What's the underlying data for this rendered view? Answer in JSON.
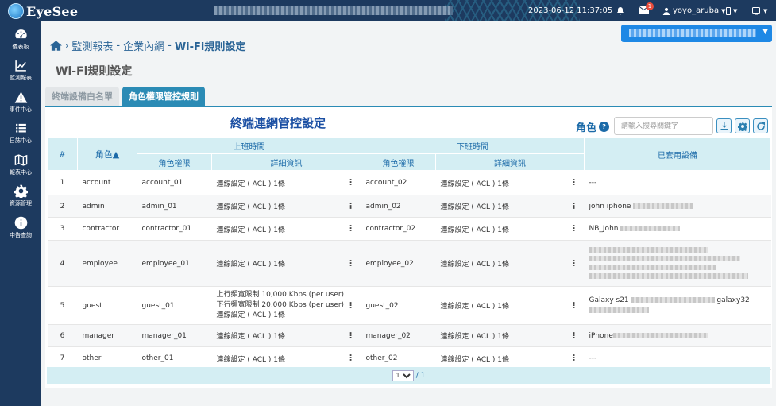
{
  "app": {
    "logo_text": "EyeSee",
    "datetime": "2023-06-12 11:37:05",
    "notif_count": "1",
    "username": "yoyo_aruba"
  },
  "sidebar": {
    "items": [
      {
        "label": "儀表板",
        "icon": "dashboard-icon"
      },
      {
        "label": "監測報表",
        "icon": "line-chart-icon"
      },
      {
        "label": "事件中心",
        "icon": "warning-icon"
      },
      {
        "label": "日誌中心",
        "icon": "list-icon"
      },
      {
        "label": "報表中心",
        "icon": "map-icon"
      },
      {
        "label": "資源管理",
        "icon": "gear-icon"
      },
      {
        "label": "申告查詢",
        "icon": "info-icon"
      }
    ]
  },
  "breadcrumb": {
    "part1": "監測報表",
    "part2": "企業內網",
    "part3": "Wi-Fi規則設定",
    "sep": "-"
  },
  "page": {
    "title": "Wi-Fi規則設定"
  },
  "tabs": [
    {
      "label": "終端設備白名單"
    },
    {
      "label": "角色權限管控規則"
    }
  ],
  "panel": {
    "title": "終端連網管控設定",
    "role_label": "角色",
    "help_mark": "?",
    "search_placeholder": "請輸入搜尋關鍵字"
  },
  "table": {
    "headers": {
      "num": "#",
      "role": "角色▲",
      "work": "上班時間",
      "offwork": "下班時間",
      "work_role": "角色權限",
      "work_detail": "詳細資訊",
      "off_role": "角色權限",
      "off_detail": "詳細資訊",
      "devices": "已套用設備"
    },
    "rows": [
      {
        "num": "1",
        "role": "account",
        "work_role": "account_01",
        "work_detail": [
          "連線設定 ( ACL ) 1條"
        ],
        "off_role": "account_02",
        "off_detail": "連線設定 ( ACL ) 1條",
        "devices": "---"
      },
      {
        "num": "2",
        "role": "admin",
        "work_role": "admin_01",
        "work_detail": [
          "連線設定 ( ACL ) 1條"
        ],
        "off_role": "admin_02",
        "off_detail": "連線設定 ( ACL ) 1條",
        "devices": "john iphone"
      },
      {
        "num": "3",
        "role": "contractor",
        "work_role": "contractor_01",
        "work_detail": [
          "連線設定 ( ACL ) 1條"
        ],
        "off_role": "contractor_02",
        "off_detail": "連線設定 ( ACL ) 1條",
        "devices": "NB_John"
      },
      {
        "num": "4",
        "role": "employee",
        "work_role": "employee_01",
        "work_detail": [
          "連線設定 ( ACL ) 1條"
        ],
        "off_role": "employee_02",
        "off_detail": "連線設定 ( ACL ) 1條",
        "devices": ""
      },
      {
        "num": "5",
        "role": "guest",
        "work_role": "guest_01",
        "work_detail": [
          "上行頻寬限制 10,000 Kbps (per user)",
          "下行頻寬限制 20,000 Kbps (per user)",
          "連線設定 ( ACL ) 1條"
        ],
        "off_role": "guest_02",
        "off_detail": "連線設定 ( ACL ) 1條",
        "devices": "Galaxy s21",
        "devices_extra": "galaxy32"
      },
      {
        "num": "6",
        "role": "manager",
        "work_role": "manager_01",
        "work_detail": [
          "連線設定 ( ACL ) 1條"
        ],
        "off_role": "manager_02",
        "off_detail": "連線設定 ( ACL ) 1條",
        "devices": "iPhone"
      },
      {
        "num": "7",
        "role": "other",
        "work_role": "other_01",
        "work_detail": [
          "連線設定 ( ACL ) 1條"
        ],
        "off_role": "other_02",
        "off_detail": "連線設定 ( ACL ) 1條",
        "devices": "---"
      }
    ]
  },
  "pager": {
    "current": "1",
    "total": "/ 1"
  },
  "colors": {
    "topbar": "#1d3a5f",
    "accent": "#2b8bb5",
    "header_bg": "#d4eef3",
    "title_blue": "#1b4fa3"
  }
}
